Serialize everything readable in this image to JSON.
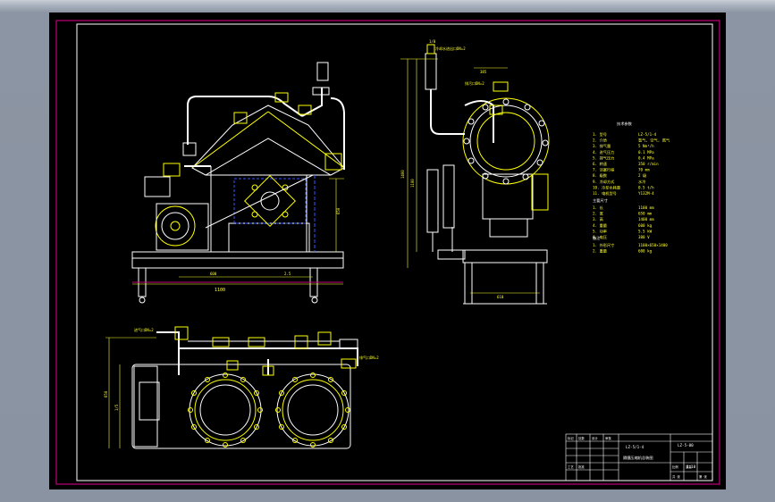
{
  "drawing": {
    "dims": {
      "front_width": "1100",
      "front_a": "600",
      "front_b": "2.5",
      "front_height": "650",
      "side_top": "1/0",
      "side_width": "385",
      "side_h1": "1100",
      "side_h2": "1400",
      "side_base": "610",
      "plan_h1": "650",
      "plan_h2": "1/5"
    },
    "callouts": {
      "left_label": "进气口DN=2",
      "right_label": "排气口DN=2",
      "side_top_label": "冷却水进出口DN=2",
      "side_mid_label": "排污口DN=2"
    },
    "specs": {
      "heading": "技术参数",
      "rows": [
        {
          "k": "1. 型号",
          "v": "LZ-5/1-4"
        },
        {
          "k": "2. 介质",
          "v": "氢气, 空气, 氮气"
        },
        {
          "k": "3. 排气量",
          "v": "5 Nm³/h"
        },
        {
          "k": "4. 进气压力",
          "v": "0.1 MPa"
        },
        {
          "k": "5. 排气压力",
          "v": "0.4 MPa"
        },
        {
          "k": "6. 转速",
          "v": "350 r/min"
        },
        {
          "k": "7. 活塞行程",
          "v": "70 mm"
        },
        {
          "k": "8. 级数",
          "v": "2 级"
        },
        {
          "k": "9. 冷却方式",
          "v": "水冷"
        },
        {
          "k": "10. 冷却水耗量",
          "v": "0.5 t/h"
        },
        {
          "k": "11. 电机型号",
          "v": "Y132M-4"
        }
      ],
      "heading2": "主要尺寸",
      "rows2": [
        {
          "k": "1. 长",
          "v": "1100 mm"
        },
        {
          "k": "2. 宽",
          "v": "650 mm"
        },
        {
          "k": "3. 高",
          "v": "1400 mm"
        },
        {
          "k": "4. 重量",
          "v": "600 kg"
        },
        {
          "k": "5. 功率",
          "v": "5.5 kW"
        },
        {
          "k": "6. 电压",
          "v": "380 V"
        }
      ],
      "heading3": "备注",
      "rows3": [
        {
          "k": "1. 外形尺寸",
          "v": "1100×650×1400"
        },
        {
          "k": "2. 重量",
          "v": "600 kg"
        }
      ]
    },
    "title_block": {
      "drawing_no": "LZ-5/1-4",
      "name": "隔膜压缩机总装图",
      "scale": "1:10",
      "sheet_code": "LZ-5-00",
      "cells": [
        "标记",
        "处数",
        "设计",
        "审核",
        "工艺",
        "批准",
        "比例",
        "重量",
        "共 张",
        "第 张"
      ]
    },
    "colors": {
      "sheet_bg": "#000000",
      "border": "#c0007a",
      "line": "#ffffff",
      "accent": "#ffff00",
      "dim": "#ffff33",
      "hidden": "#3355ff"
    }
  }
}
